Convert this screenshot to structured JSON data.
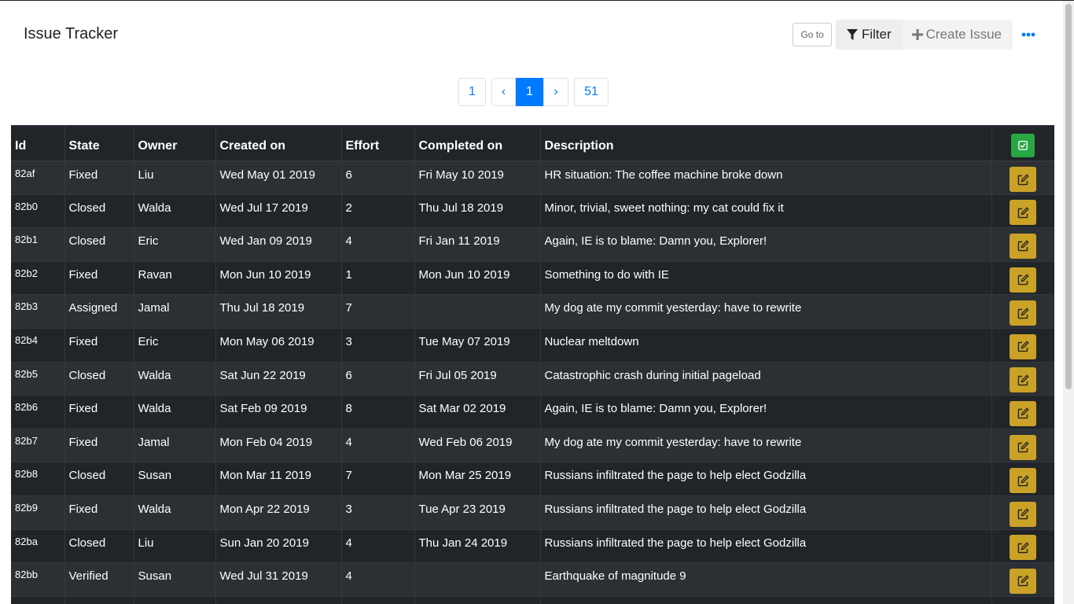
{
  "header": {
    "title": "Issue Tracker",
    "goto_label": "Go to",
    "filter_label": "Filter",
    "create_label": "Create Issue"
  },
  "pagination": {
    "first": "1",
    "prev": "‹",
    "current": "1",
    "next": "›",
    "last": "51"
  },
  "table": {
    "columns": [
      "Id",
      "State",
      "Owner",
      "Created on",
      "Effort",
      "Completed on",
      "Description"
    ],
    "rows": [
      {
        "id": "82af",
        "state": "Fixed",
        "owner": "Liu",
        "created": "Wed May 01 2019",
        "effort": "6",
        "completed": "Fri May 10 2019",
        "description": "HR situation: The coffee machine broke down"
      },
      {
        "id": "82b0",
        "state": "Closed",
        "owner": "Walda",
        "created": "Wed Jul 17 2019",
        "effort": "2",
        "completed": "Thu Jul 18 2019",
        "description": "Minor, trivial, sweet nothing: my cat could fix it"
      },
      {
        "id": "82b1",
        "state": "Closed",
        "owner": "Eric",
        "created": "Wed Jan 09 2019",
        "effort": "4",
        "completed": "Fri Jan 11 2019",
        "description": "Again, IE is to blame: Damn you, Explorer!"
      },
      {
        "id": "82b2",
        "state": "Fixed",
        "owner": "Ravan",
        "created": "Mon Jun 10 2019",
        "effort": "1",
        "completed": "Mon Jun 10 2019",
        "description": "Something to do with IE"
      },
      {
        "id": "82b3",
        "state": "Assigned",
        "owner": "Jamal",
        "created": "Thu Jul 18 2019",
        "effort": "7",
        "completed": "",
        "description": "My dog ate my commit yesterday: have to rewrite"
      },
      {
        "id": "82b4",
        "state": "Fixed",
        "owner": "Eric",
        "created": "Mon May 06 2019",
        "effort": "3",
        "completed": "Tue May 07 2019",
        "description": "Nuclear meltdown"
      },
      {
        "id": "82b5",
        "state": "Closed",
        "owner": "Walda",
        "created": "Sat Jun 22 2019",
        "effort": "6",
        "completed": "Fri Jul 05 2019",
        "description": "Catastrophic crash during initial pageload"
      },
      {
        "id": "82b6",
        "state": "Fixed",
        "owner": "Walda",
        "created": "Sat Feb 09 2019",
        "effort": "8",
        "completed": "Sat Mar 02 2019",
        "description": "Again, IE is to blame: Damn you, Explorer!"
      },
      {
        "id": "82b7",
        "state": "Fixed",
        "owner": "Jamal",
        "created": "Mon Feb 04 2019",
        "effort": "4",
        "completed": "Wed Feb 06 2019",
        "description": "My dog ate my commit yesterday: have to rewrite"
      },
      {
        "id": "82b8",
        "state": "Closed",
        "owner": "Susan",
        "created": "Mon Mar 11 2019",
        "effort": "7",
        "completed": "Mon Mar 25 2019",
        "description": "Russians infiltrated the page to help elect Godzilla"
      },
      {
        "id": "82b9",
        "state": "Fixed",
        "owner": "Walda",
        "created": "Mon Apr 22 2019",
        "effort": "3",
        "completed": "Tue Apr 23 2019",
        "description": "Russians infiltrated the page to help elect Godzilla"
      },
      {
        "id": "82ba",
        "state": "Closed",
        "owner": "Liu",
        "created": "Sun Jan 20 2019",
        "effort": "4",
        "completed": "Thu Jan 24 2019",
        "description": "Russians infiltrated the page to help elect Godzilla"
      },
      {
        "id": "82bb",
        "state": "Verified",
        "owner": "Susan",
        "created": "Wed Jul 31 2019",
        "effort": "4",
        "completed": "",
        "description": "Earthquake of magnitude 9"
      }
    ]
  },
  "icons": {
    "filter": "filter-icon",
    "create": "plus-icon",
    "more": "ellipsis-icon",
    "select_all": "check-square-icon",
    "edit": "edit-icon"
  },
  "colors": {
    "accent": "#007bff",
    "table_bg": "#212529",
    "table_row_alt": "#2c3034",
    "edit_button": "#c9a227",
    "select_all_button": "#28a745"
  }
}
